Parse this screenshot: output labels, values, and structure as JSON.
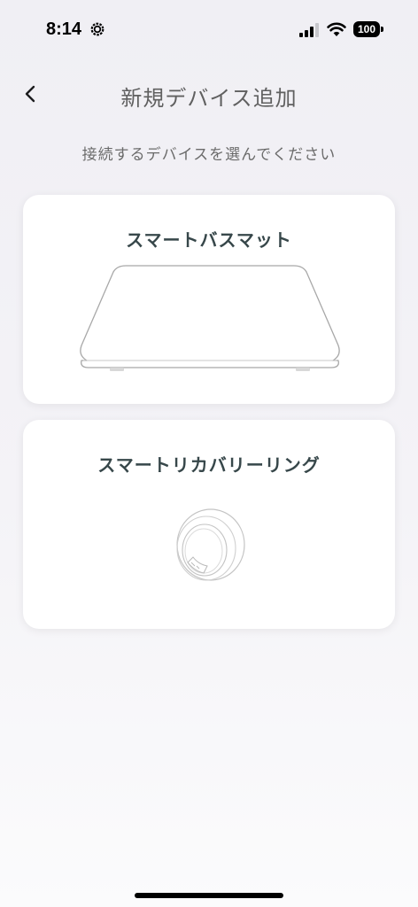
{
  "status_bar": {
    "time": "8:14",
    "battery": "100",
    "icons": [
      "settings-gear-icon",
      "cellular-signal-icon",
      "wifi-icon",
      "battery-icon"
    ]
  },
  "header": {
    "title": "新規デバイス追加",
    "back_icon": "chevron-left-icon"
  },
  "subtitle": "接続するデバイスを選んでください",
  "devices": [
    {
      "label": "スマートバスマット",
      "icon": "bath-mat-illustration"
    },
    {
      "label": "スマートリカバリーリング",
      "icon": "ring-illustration"
    }
  ],
  "colors": {
    "background": "#f0eff4",
    "card": "#ffffff",
    "title_text": "#606060",
    "card_label": "#37474a"
  }
}
